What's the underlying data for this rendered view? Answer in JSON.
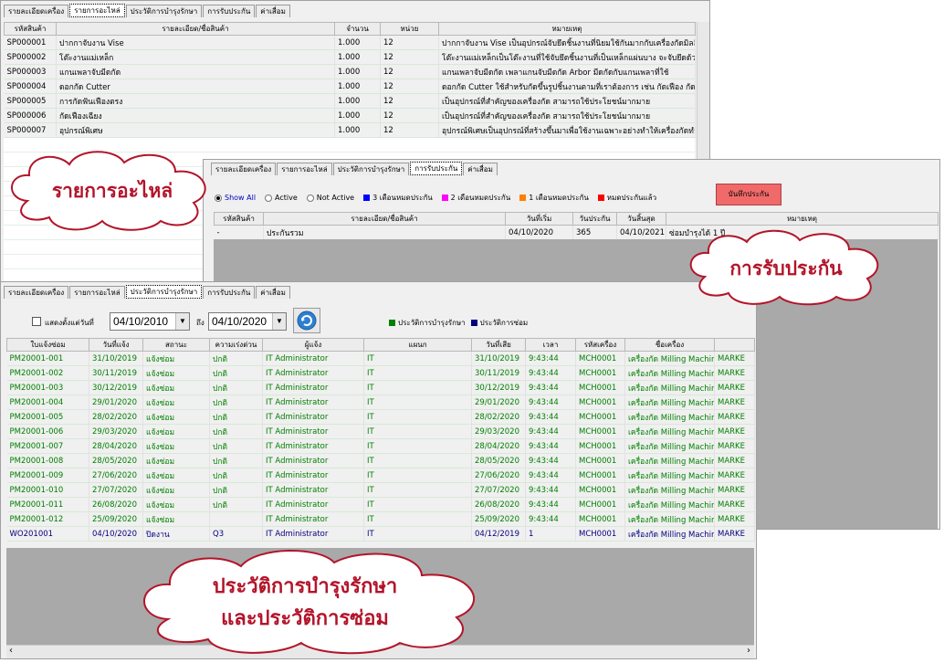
{
  "top_window": {
    "tabs": [
      {
        "label": "รายละเอียดเครื่อง",
        "active": false
      },
      {
        "label": "รายการอะไหล่",
        "active": true
      },
      {
        "label": "ประวัติการบำรุงรักษา",
        "active": false
      },
      {
        "label": "การรับประกัน",
        "active": false
      },
      {
        "label": "ค่าเสื่อม",
        "active": false
      }
    ],
    "columns": [
      "รหัสสินค้า",
      "รายละเอียด/ชื่อสินค้า",
      "จำนวน",
      "หน่วย",
      "หมายเหตุ"
    ],
    "rows": [
      [
        "SP000001",
        "ปากกาจับงาน Vise",
        "1.000",
        "12",
        "ปากกาจับงาน Vise เป็นอุปกรณ์จับยึดชิ้นงานที่นิยมใช้กันมากกับเครื่องกัดมิลลิ่ง"
      ],
      [
        "SP000002",
        "โต๊ะงานแม่เหล็ก",
        "1.000",
        "12",
        "โต๊ะงานแม่เหล็กเป็นโต๊ะงานที่ใช้จับยึดชิ้นงานที่เป็นเหล็กแผ่นบาง จะจับยึดด้วย"
      ],
      [
        "SP000003",
        "แกนเพลาจับมีดกัด",
        "1.000",
        "12",
        "แกนเพลาจับมีดกัด เพลาแกนจับมีดกัด Arbor มีดกัดกับแกนเพลาที่ใช้"
      ],
      [
        "SP000004",
        "ดอกกัด Cutter",
        "1.000",
        "12",
        "ดอกกัด Cutter ใช้สำหรับกัดขึ้นรูปชิ้นงานตามที่เราต้องการ เช่น กัดเฟือง กัดแบบ"
      ],
      [
        "SP000005",
        "การกัดฟันเฟืองตรง",
        "1.000",
        "12",
        "เป็นอุปกรณ์ที่สำคัญของเครื่องกัด สามารถใช้ประโยชน์มากมาย"
      ],
      [
        "SP000006",
        "กัดเฟืองเฉียง",
        "1.000",
        "12",
        "เป็นอุปกรณ์ที่สำคัญของเครื่องกัด สามารถใช้ประโยชน์มากมาย"
      ],
      [
        "SP000007",
        "อุปกรณ์พิเศษ",
        "1.000",
        "12",
        "อุปกรณ์พิเศษเป็นอุปกรณ์ที่สร้างขึ้นมาเพื่อใช้งานเฉพาะอย่างทำให้เครื่องกัดทำงาน"
      ]
    ]
  },
  "warranty_window": {
    "tabs": [
      {
        "label": "รายละเอียดเครื่อง",
        "active": false
      },
      {
        "label": "รายการอะไหล่",
        "active": false
      },
      {
        "label": "ประวัติการบำรุงรักษา",
        "active": false
      },
      {
        "label": "การรับประกัน",
        "active": true
      },
      {
        "label": "ค่าเสื่อม",
        "active": false
      }
    ],
    "filters": [
      {
        "label": "Show All",
        "selected": true
      },
      {
        "label": "Active",
        "selected": false
      },
      {
        "label": "Not Active",
        "selected": false
      }
    ],
    "legend": [
      {
        "label": "3 เดือนหมดประกัน",
        "color": "#0000ff"
      },
      {
        "label": "2 เดือนหมดประกัน",
        "color": "#ff00ff"
      },
      {
        "label": "1 เดือนหมดประกัน",
        "color": "#ff8000"
      },
      {
        "label": "หมดประกันแล้ว",
        "color": "#ff0000"
      }
    ],
    "save_button": "บันทึกประกัน",
    "columns": [
      "รหัสสินค้า",
      "รายละเอียด/ชื่อสินค้า",
      "วันที่เริ่ม",
      "วันประกัน",
      "วันสิ้นสุด",
      "หมายเหตุ"
    ],
    "rows": [
      [
        "-",
        "ประกันรวม",
        "04/10/2020",
        "365",
        "04/10/2021",
        "ซ่อมบำรุงได้ 1 ปี"
      ]
    ]
  },
  "history_window": {
    "tabs": [
      {
        "label": "รายละเอียดเครื่อง",
        "active": false
      },
      {
        "label": "รายการอะไหล่",
        "active": false
      },
      {
        "label": "ประวัติการบำรุงรักษา",
        "active": true
      },
      {
        "label": "การรับประกัน",
        "active": false
      },
      {
        "label": "ค่าเสื่อม",
        "active": false
      }
    ],
    "show_from_label": "แสดงตั้งแต่วันที่",
    "date_from": "04/10/2010",
    "to_label": "ถึง",
    "date_to": "04/10/2020",
    "legend": [
      {
        "label": "ประวัติการบำรุงรักษา",
        "color": "#008000"
      },
      {
        "label": "ประวัติการซ่อม",
        "color": "#000080"
      }
    ],
    "columns": [
      "ใบแจ้งซ่อม",
      "วันที่แจ้ง",
      "สถานะ",
      "ความเร่งด่วน",
      "ผู้แจ้ง",
      "แผนก",
      "วันที่เสีย",
      "เวลา",
      "รหัสเครื่อง",
      "ชื่อเครื่อง",
      ""
    ],
    "rows": [
      [
        "PM20001-001",
        "31/10/2019",
        "แจ้งซ่อม",
        "ปกติ",
        "IT Administrator",
        "IT",
        "31/10/2019",
        "9:43:44",
        "MCH0001",
        "เครื่องกัด Milling Machin",
        "MARKE"
      ],
      [
        "PM20001-002",
        "30/11/2019",
        "แจ้งซ่อม",
        "ปกติ",
        "IT Administrator",
        "IT",
        "30/11/2019",
        "9:43:44",
        "MCH0001",
        "เครื่องกัด Milling Machin",
        "MARKE"
      ],
      [
        "PM20001-003",
        "30/12/2019",
        "แจ้งซ่อม",
        "ปกติ",
        "IT Administrator",
        "IT",
        "30/12/2019",
        "9:43:44",
        "MCH0001",
        "เครื่องกัด Milling Machin",
        "MARKE"
      ],
      [
        "PM20001-004",
        "29/01/2020",
        "แจ้งซ่อม",
        "ปกติ",
        "IT Administrator",
        "IT",
        "29/01/2020",
        "9:43:44",
        "MCH0001",
        "เครื่องกัด Milling Machin",
        "MARKE"
      ],
      [
        "PM20001-005",
        "28/02/2020",
        "แจ้งซ่อม",
        "ปกติ",
        "IT Administrator",
        "IT",
        "28/02/2020",
        "9:43:44",
        "MCH0001",
        "เครื่องกัด Milling Machin",
        "MARKE"
      ],
      [
        "PM20001-006",
        "29/03/2020",
        "แจ้งซ่อม",
        "ปกติ",
        "IT Administrator",
        "IT",
        "29/03/2020",
        "9:43:44",
        "MCH0001",
        "เครื่องกัด Milling Machin",
        "MARKE"
      ],
      [
        "PM20001-007",
        "28/04/2020",
        "แจ้งซ่อม",
        "ปกติ",
        "IT Administrator",
        "IT",
        "28/04/2020",
        "9:43:44",
        "MCH0001",
        "เครื่องกัด Milling Machin",
        "MARKE"
      ],
      [
        "PM20001-008",
        "28/05/2020",
        "แจ้งซ่อม",
        "ปกติ",
        "IT Administrator",
        "IT",
        "28/05/2020",
        "9:43:44",
        "MCH0001",
        "เครื่องกัด Milling Machin",
        "MARKE"
      ],
      [
        "PM20001-009",
        "27/06/2020",
        "แจ้งซ่อม",
        "ปกติ",
        "IT Administrator",
        "IT",
        "27/06/2020",
        "9:43:44",
        "MCH0001",
        "เครื่องกัด Milling Machin",
        "MARKE"
      ],
      [
        "PM20001-010",
        "27/07/2020",
        "แจ้งซ่อม",
        "ปกติ",
        "IT Administrator",
        "IT",
        "27/07/2020",
        "9:43:44",
        "MCH0001",
        "เครื่องกัด Milling Machin",
        "MARKE"
      ],
      [
        "PM20001-011",
        "26/08/2020",
        "แจ้งซ่อม",
        "ปกติ",
        "IT Administrator",
        "IT",
        "26/08/2020",
        "9:43:44",
        "MCH0001",
        "เครื่องกัด Milling Machin",
        "MARKE"
      ],
      [
        "PM20001-012",
        "25/09/2020",
        "แจ้งซ่อม",
        "",
        "IT Administrator",
        "IT",
        "25/09/2020",
        "9:43:44",
        "MCH0001",
        "เครื่องกัด Milling Machin",
        "MARKE"
      ],
      [
        "WO201001",
        "04/10/2020",
        "ปิดงาน",
        "Q3",
        "IT Administrator",
        "IT",
        "04/12/2019",
        "1",
        "MCH0001",
        "เครื่องกัด Milling Machin",
        "MARKE"
      ]
    ],
    "row_colors": [
      "#008000",
      "#008000",
      "#008000",
      "#008000",
      "#008000",
      "#008000",
      "#008000",
      "#008000",
      "#008000",
      "#008000",
      "#008000",
      "#008000",
      "#000080"
    ]
  },
  "callouts": {
    "spare_parts": "รายการอะไหล่",
    "warranty": "การรับประกัน",
    "history_line1": "ประวัติการบำรุงรักษา",
    "history_line2": "และประวัติการซ่อม"
  }
}
